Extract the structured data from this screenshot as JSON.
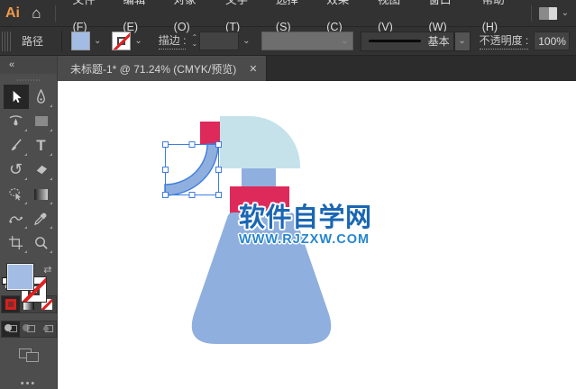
{
  "app": {
    "logo_label": "Ai"
  },
  "menubar": {
    "items": [
      "文件(F)",
      "编辑(E)",
      "对象(O)",
      "文字(T)",
      "选择(S)",
      "效果(C)",
      "视图(V)",
      "窗口(W)",
      "帮助(H)"
    ]
  },
  "control_bar": {
    "context_label": "路径",
    "stroke_label": "描边 :",
    "brush_style": "基本",
    "opacity_label": "不透明度 :",
    "opacity_value": "100%"
  },
  "tab": {
    "title": "未标题-1* @ 71.24% (CMYK/预览)"
  },
  "toolbar": {
    "tools": [
      "selection",
      "pen",
      "curvature",
      "rectangle",
      "paintbrush",
      "type",
      "rotate",
      "eraser",
      "shaper",
      "gradient",
      "puppet-warp",
      "eyedropper",
      "artboard",
      "zoom"
    ]
  },
  "watermark": {
    "title": "软件自学网",
    "url": "WWW.RJZXW.COM"
  },
  "glyphs": {
    "home": "⌂",
    "collapse": "«",
    "close": "✕",
    "chevron_down": "⌄",
    "chevron_up": "⌃",
    "type_tool": "T",
    "rotate_tool": "↺",
    "swap": "⇄",
    "more": "•••"
  },
  "colors": {
    "ai_logo_orange": "#f09a4d",
    "fill_blue": "#a3bce4",
    "artwork_body_blue": "#8fafde",
    "artwork_head_cyan": "#c5e2eb",
    "artwork_red": "#dd2a5b",
    "selection_blue": "#3e7de0",
    "watermark_title_blue": "#1a66b3",
    "watermark_url_blue": "#2585cd"
  }
}
